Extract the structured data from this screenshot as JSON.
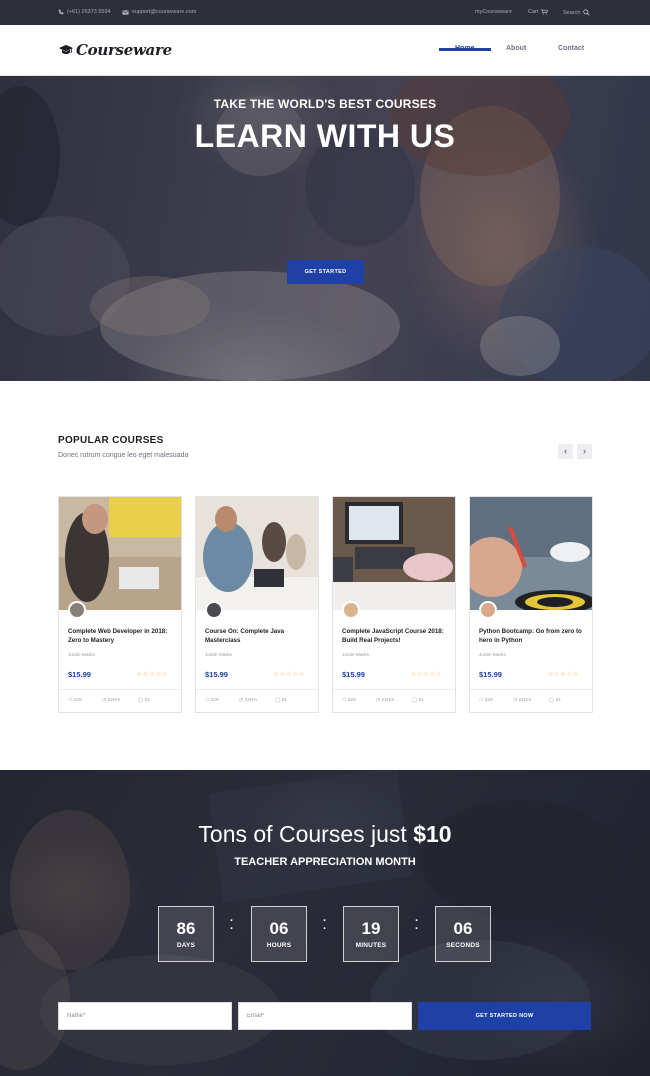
{
  "topbar": {
    "phone": "(+61) 26373 5594",
    "email": "support@courseware.com",
    "my_courseware": "myCourseware",
    "cart": "Cart",
    "search": "Search"
  },
  "header": {
    "logo": "Courseware",
    "nav": [
      {
        "label": "Home",
        "active": true
      },
      {
        "label": "About",
        "active": false
      },
      {
        "label": "Contact",
        "active": false
      }
    ]
  },
  "hero": {
    "subtitle": "TAKE THE WORLD'S BEST COURSES",
    "title": "LEARN WITH US",
    "button": "GET STARTED"
  },
  "popular": {
    "title": "POPULAR COURSES",
    "subtitle": "Donec rutrum congue leo eget malesuada",
    "prev": "‹",
    "next": "›",
    "courses": [
      {
        "title": "Complete Web Developer in 2018: Zero to Mastery",
        "author": "Justin Marks",
        "price": "$15.99",
        "rating": "☆☆☆☆☆",
        "students": "329",
        "duration": "22Hrs",
        "comments": "51"
      },
      {
        "title": "Course On: Complete Java Masterclass",
        "author": "Justin Marks",
        "price": "$15.99",
        "rating": "☆☆☆☆☆",
        "students": "329",
        "duration": "22Hrs",
        "comments": "51"
      },
      {
        "title": "Complete JavaScript Course 2018: Build Real Projects!",
        "author": "Justin Marks",
        "price": "$15.99",
        "rating": "☆☆☆☆☆",
        "students": "329",
        "duration": "22Hrs",
        "comments": "51"
      },
      {
        "title": "Python Bootcamp: Go from zero to hero in Python",
        "author": "Justin Marks",
        "price": "$15.99",
        "rating": "☆☆☆☆☆",
        "students": "329",
        "duration": "22Hrs",
        "comments": "51"
      }
    ]
  },
  "promo": {
    "title_prefix": "Tons of Courses just ",
    "title_price": "$10",
    "subtitle": "TEACHER APPRECIATION MONTH",
    "countdown": [
      {
        "value": "86",
        "label": "DAYS"
      },
      {
        "value": "06",
        "label": "HOURS"
      },
      {
        "value": "19",
        "label": "MINUTES"
      },
      {
        "value": "06",
        "label": "SECONDS"
      }
    ],
    "name_placeholder": "Name*",
    "email_placeholder": "Email*",
    "button": "GET STARTED NOW"
  },
  "colors": {
    "accent": "#1e40a7",
    "topbar_bg": "#2d2f3a",
    "star": "#f2a73b"
  }
}
